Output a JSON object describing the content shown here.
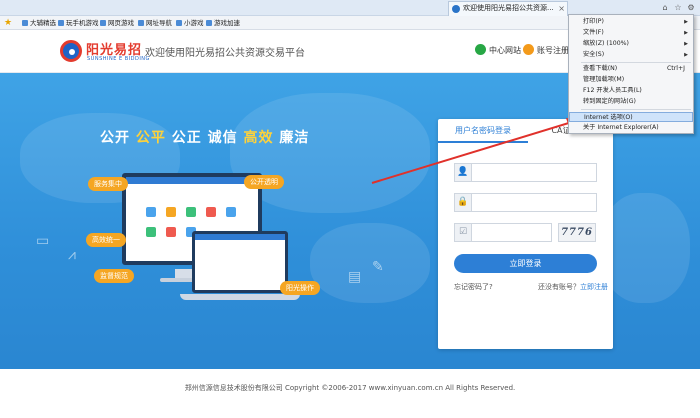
{
  "browser": {
    "tab_title": "欢迎使用阳光易招公共资源...",
    "tab_close": "×"
  },
  "favorites": {
    "items": [
      {
        "label": "大辅精选"
      },
      {
        "label": "玩手机游戏"
      },
      {
        "label": "网页游戏"
      },
      {
        "label": "网址导航"
      },
      {
        "label": "小游戏"
      },
      {
        "label": "游戏加速"
      }
    ]
  },
  "header": {
    "logo_cn": "阳光易招",
    "logo_en": "SUNSHINE E BIDDING",
    "slogan": "欢迎使用阳光易招公共资源交易平台",
    "center_site": "中心网站",
    "account_register": "账号注册"
  },
  "hero": {
    "slogan_parts": [
      "公开 ",
      "公平",
      " 公正  诚信 ",
      "高效",
      " 廉洁"
    ],
    "tags": [
      "服务集中",
      "公开透明",
      "高效统一",
      "监督规范",
      "阳光操作"
    ],
    "captcha": "7776"
  },
  "login": {
    "tab_user": "用户名密码登录",
    "tab_ca": "CA证书登录",
    "username_placeholder": "",
    "password_placeholder": "",
    "captcha_placeholder": "",
    "login_button": "立即登录",
    "forgot": "忘记密码了?",
    "no_account": "还没有账号？",
    "register_now": "立即注册"
  },
  "footer": {
    "text": "郑州信源信息技术股份有限公司 Copyright ©2006-2017 www.xinyuan.com.cn All Rights Reserved."
  },
  "tools_menu": {
    "items": [
      {
        "label": "打印(P)",
        "submenu": true
      },
      {
        "label": "文件(F)",
        "submenu": true
      },
      {
        "label": "缩放(Z) (100%)",
        "submenu": true
      },
      {
        "label": "安全(S)",
        "submenu": true
      },
      {
        "label": "查看下载(N)",
        "shortcut": "Ctrl+J"
      },
      {
        "label": "管理加载项(M)"
      },
      {
        "label": "F12 开发人员工具(L)"
      },
      {
        "label": "转到固定的网站(G)"
      },
      {
        "label": "Internet 选项(O)",
        "highlighted": true
      },
      {
        "label": "关于 Internet Explorer(A)"
      }
    ]
  },
  "colors": {
    "hero_blue": "#2f8fd9",
    "accent_blue": "#2d7fd6",
    "highlight_yellow": "#ffd23a",
    "annotation_red": "#e0312b"
  }
}
